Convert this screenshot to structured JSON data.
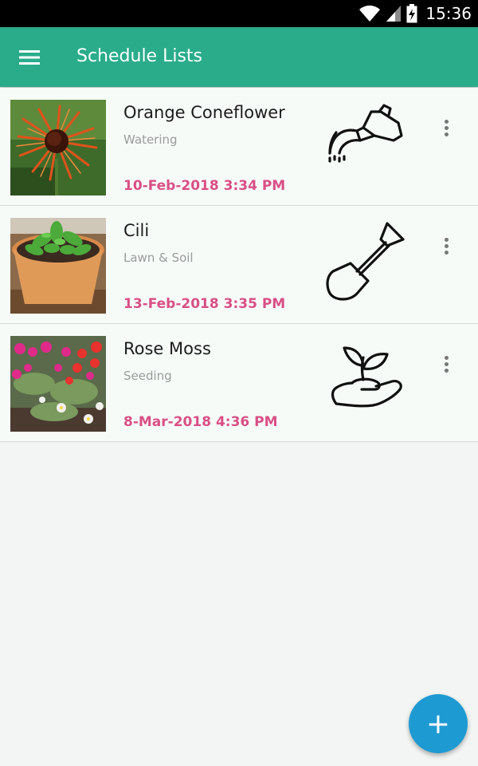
{
  "status_bar": {
    "time": "15:36",
    "icons": [
      "wifi-icon",
      "cell-signal-icon",
      "battery-charging-icon"
    ]
  },
  "app_bar": {
    "menu_icon": "hamburger-menu-icon",
    "title": "Schedule Lists"
  },
  "schedules": [
    {
      "name": "Orange Coneflower",
      "task": "Watering",
      "date": "10-Feb-2018 3:34 PM",
      "task_icon": "watering-can-icon",
      "photo": "orange-coneflower-photo"
    },
    {
      "name": "Cili",
      "task": "Lawn & Soil",
      "date": "13-Feb-2018 3:35 PM",
      "task_icon": "shovel-icon",
      "photo": "chili-plant-photo"
    },
    {
      "name": "Rose Moss",
      "task": "Seeding",
      "date": "8-Mar-2018 4:36 PM",
      "task_icon": "seedling-hand-icon",
      "photo": "rose-moss-photo"
    }
  ],
  "fab": {
    "label": "+",
    "icon": "add-icon"
  },
  "colors": {
    "app_bar": "#2aac8a",
    "date_text": "#d94f86",
    "fab": "#1e9ad3",
    "background": "#f2f5f3"
  }
}
